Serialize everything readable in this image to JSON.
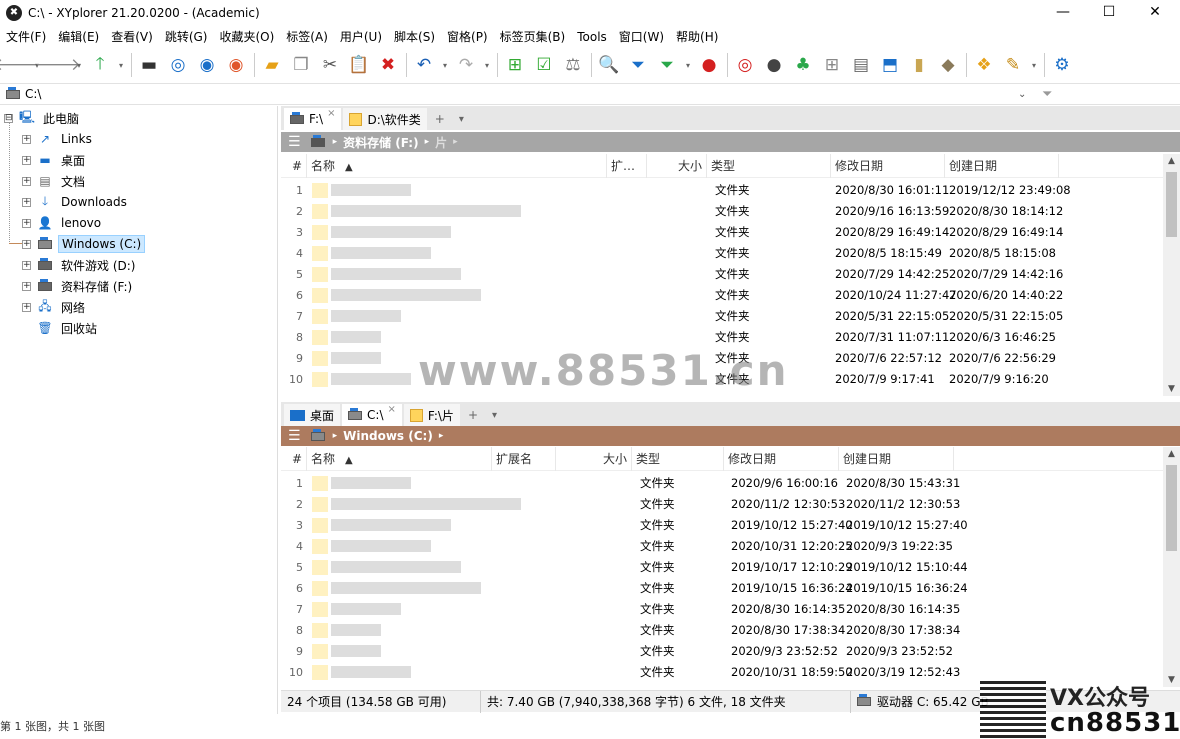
{
  "window": {
    "title": "C:\\ - XYplorer 21.20.0200 - (Academic)",
    "app_icon_glyph": "✖",
    "controls": {
      "minimize": "—",
      "maximize": "☐",
      "close": "✕"
    }
  },
  "menu": [
    "文件(F)",
    "编辑(E)",
    "查看(V)",
    "跳转(G)",
    "收藏夹(O)",
    "标签(A)",
    "用户(U)",
    "脚本(S)",
    "窗格(P)",
    "标签页集(B)",
    "Tools",
    "窗口(W)",
    "帮助(H)"
  ],
  "address": {
    "path": "C:\\"
  },
  "tree": [
    {
      "label": "此电脑",
      "expander": "⊟",
      "icon": "computer-icon"
    },
    {
      "label": "Links",
      "expander": "+",
      "icon": "links-folder-icon"
    },
    {
      "label": "桌面",
      "expander": "+",
      "icon": "desktop-icon"
    },
    {
      "label": "文档",
      "expander": "+",
      "icon": "documents-icon"
    },
    {
      "label": "Downloads",
      "expander": "+",
      "icon": "downloads-icon"
    },
    {
      "label": "lenovo",
      "expander": "+",
      "icon": "user-icon"
    },
    {
      "label": "Windows (C:)",
      "expander": "+",
      "icon": "drive-icon"
    },
    {
      "label": "软件游戏 (D:)",
      "expander": "+",
      "icon": "drive-icon"
    },
    {
      "label": "资料存储 (F:)",
      "expander": "+",
      "icon": "drive-icon"
    },
    {
      "label": "网络",
      "expander": "+",
      "icon": "network-icon"
    },
    {
      "label": "回收站",
      "expander": "",
      "icon": "recycle-bin-icon"
    }
  ],
  "pane1": {
    "tabs": [
      {
        "label": "F:\\",
        "close": "×"
      },
      {
        "label": "D:\\软件类",
        "close": ""
      }
    ],
    "tab_add": "+",
    "tab_menu": "▾",
    "crumbs": [
      "资料存储 (F:)",
      "片"
    ],
    "columns": {
      "num": "#",
      "name": "名称",
      "ext": "扩…",
      "size": "大小",
      "type": "类型",
      "modified": "修改日期",
      "created": "创建日期"
    },
    "rows": [
      {
        "n": "1",
        "type": "文件夹",
        "mod": "2020/8/30 16:01:11",
        "cre": "2019/12/12 23:49:08"
      },
      {
        "n": "2",
        "type": "文件夹",
        "mod": "2020/9/16 16:13:59",
        "cre": "2020/8/30 18:14:12"
      },
      {
        "n": "3",
        "type": "文件夹",
        "mod": "2020/8/29 16:49:14",
        "cre": "2020/8/29 16:49:14"
      },
      {
        "n": "4",
        "type": "文件夹",
        "mod": "2020/8/5 18:15:49",
        "cre": "2020/8/5 18:15:08"
      },
      {
        "n": "5",
        "type": "文件夹",
        "mod": "2020/7/29 14:42:25",
        "cre": "2020/7/29 14:42:16"
      },
      {
        "n": "6",
        "type": "文件夹",
        "mod": "2020/10/24 11:27:47",
        "cre": "2020/6/20 14:40:22"
      },
      {
        "n": "7",
        "type": "文件夹",
        "mod": "2020/5/31 22:15:05",
        "cre": "2020/5/31 22:15:05"
      },
      {
        "n": "8",
        "type": "文件夹",
        "mod": "2020/7/31 11:07:11",
        "cre": "2020/6/3 16:46:25"
      },
      {
        "n": "9",
        "type": "文件夹",
        "mod": "2020/7/6 22:57:12",
        "cre": "2020/7/6 22:56:29"
      },
      {
        "n": "10",
        "type": "文件夹",
        "mod": "2020/7/9 9:17:41",
        "cre": "2020/7/9 9:16:20"
      }
    ]
  },
  "pane2": {
    "tabs": [
      {
        "label": "桌面",
        "close": ""
      },
      {
        "label": "C:\\",
        "close": "×"
      },
      {
        "label": "F:\\片",
        "close": ""
      }
    ],
    "tab_add": "+",
    "tab_menu": "▾",
    "crumbs": [
      "Windows (C:)"
    ],
    "columns": {
      "num": "#",
      "name": "名称",
      "ext": "扩展名",
      "size": "大小",
      "type": "类型",
      "modified": "修改日期",
      "created": "创建日期"
    },
    "rows": [
      {
        "n": "1",
        "type": "文件夹",
        "mod": "2020/9/6 16:00:16",
        "cre": "2020/8/30 15:43:31"
      },
      {
        "n": "2",
        "type": "文件夹",
        "mod": "2020/11/2 12:30:53",
        "cre": "2020/11/2 12:30:53"
      },
      {
        "n": "3",
        "type": "文件夹",
        "mod": "2019/10/12 15:27:40",
        "cre": "2019/10/12 15:27:40"
      },
      {
        "n": "4",
        "type": "文件夹",
        "mod": "2020/10/31 12:20:25",
        "cre": "2020/9/3 19:22:35"
      },
      {
        "n": "5",
        "type": "文件夹",
        "mod": "2019/10/17 12:10:29",
        "cre": "2019/10/12 15:10:44"
      },
      {
        "n": "6",
        "type": "文件夹",
        "mod": "2019/10/15 16:36:24",
        "cre": "2019/10/15 16:36:24"
      },
      {
        "n": "7",
        "type": "文件夹",
        "mod": "2020/8/30 16:14:35",
        "cre": "2020/8/30 16:14:35"
      },
      {
        "n": "8",
        "type": "文件夹",
        "mod": "2020/8/30 17:38:34",
        "cre": "2020/8/30 17:38:34"
      },
      {
        "n": "9",
        "type": "文件夹",
        "mod": "2020/9/3 23:52:52",
        "cre": "2020/9/3 23:52:52"
      },
      {
        "n": "10",
        "type": "文件夹",
        "mod": "2020/10/31 18:59:50",
        "cre": "2020/3/19 12:52:43"
      }
    ]
  },
  "status": {
    "items": "24 个项目 (134.58 GB 可用)",
    "total": "共: 7.40 GB (7,940,338,368 字节)  6 文件, 18 文件夹",
    "drive": "驱动器 C:  65.42 GB"
  },
  "viewer": {
    "text": "第 1 张图，共 1 张图"
  },
  "watermark": {
    "site": "www.88531.cn",
    "vx": "VX公众号",
    "cn": "cn88531"
  },
  "colors": {
    "crumb_gray": "#a6a6a6",
    "crumb_brown": "#ad7b5f",
    "tab_strip": "#e7e7e7"
  }
}
